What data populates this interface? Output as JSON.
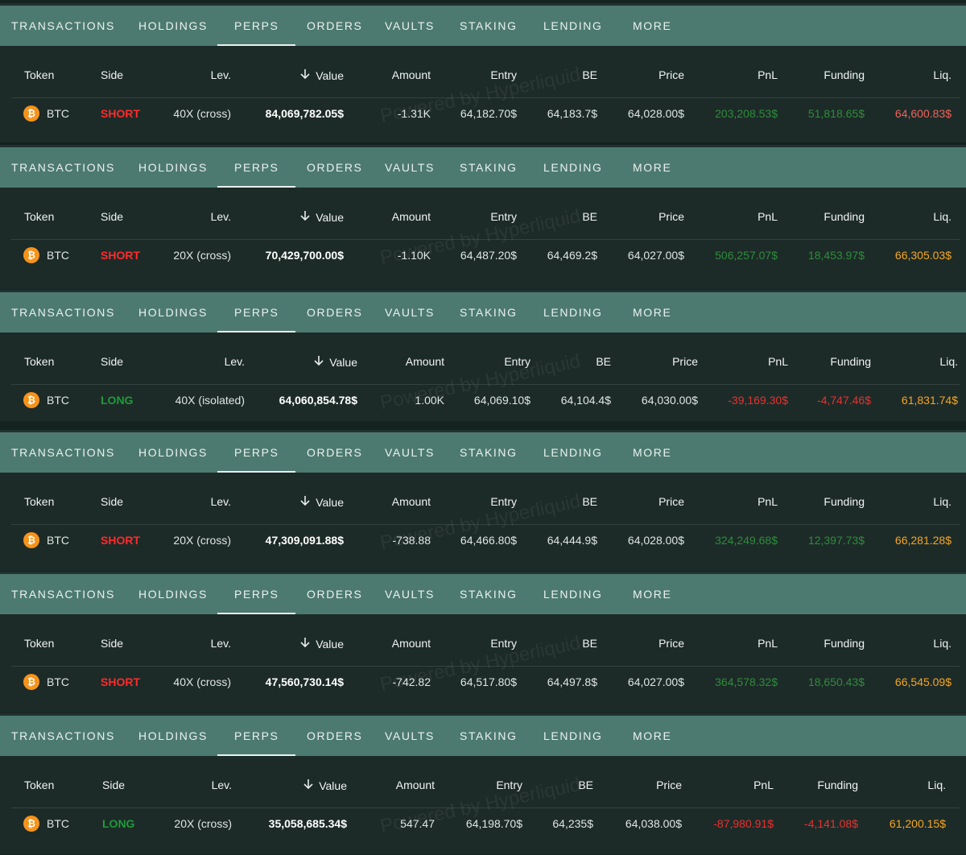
{
  "tabs": [
    "TRANSACTIONS",
    "HOLDINGS",
    "PERPS",
    "ORDERS",
    "VAULTS",
    "STAKING",
    "LENDING",
    "MORE"
  ],
  "active_tab": "PERPS",
  "columns": {
    "token": "Token",
    "side": "Side",
    "lev": "Lev.",
    "value": "Value",
    "amount": "Amount",
    "entry": "Entry",
    "be": "BE",
    "price": "Price",
    "pnl": "PnL",
    "funding": "Funding",
    "liq": "Liq."
  },
  "watermark": "Powered by Hyperliquid",
  "coin_symbol": "₿",
  "colors": {
    "tab_bar": "#4d7a70",
    "background": "#1d2b28",
    "short": "#ff2b2b",
    "long": "#1f9a3a",
    "profit": "#2f8c3c",
    "loss": "#e8312f",
    "liq": "#f5a623"
  },
  "panels": [
    {
      "token": "BTC",
      "side": "SHORT",
      "lev": "40X (cross)",
      "value": "84,069,782.05$",
      "amount": "-1.31K",
      "entry": "64,182.70$",
      "be": "64,183.7$",
      "price": "64,028.00$",
      "pnl": "203,208.53$",
      "funding": "51,818.65$",
      "liq": "64,600.83$"
    },
    {
      "token": "BTC",
      "side": "SHORT",
      "lev": "20X (cross)",
      "value": "70,429,700.00$",
      "amount": "-1.10K",
      "entry": "64,487.20$",
      "be": "64,469.2$",
      "price": "64,027.00$",
      "pnl": "506,257.07$",
      "funding": "18,453.97$",
      "liq": "66,305.03$"
    },
    {
      "token": "BTC",
      "side": "LONG",
      "lev": "40X (isolated)",
      "value": "64,060,854.78$",
      "amount": "1.00K",
      "entry": "64,069.10$",
      "be": "64,104.4$",
      "price": "64,030.00$",
      "pnl": "-39,169.30$",
      "funding": "-4,747.46$",
      "liq": "61,831.74$"
    },
    {
      "token": "BTC",
      "side": "SHORT",
      "lev": "20X (cross)",
      "value": "47,309,091.88$",
      "amount": "-738.88",
      "entry": "64,466.80$",
      "be": "64,444.9$",
      "price": "64,028.00$",
      "pnl": "324,249.68$",
      "funding": "12,397.73$",
      "liq": "66,281.28$"
    },
    {
      "token": "BTC",
      "side": "SHORT",
      "lev": "40X (cross)",
      "value": "47,560,730.14$",
      "amount": "-742.82",
      "entry": "64,517.80$",
      "be": "64,497.8$",
      "price": "64,027.00$",
      "pnl": "364,578.32$",
      "funding": "18,650.43$",
      "liq": "66,545.09$"
    },
    {
      "token": "BTC",
      "side": "LONG",
      "lev": "20X (cross)",
      "value": "35,058,685.34$",
      "amount": "547.47",
      "entry": "64,198.70$",
      "be": "64,235$",
      "price": "64,038.00$",
      "pnl": "-87,980.91$",
      "funding": "-4,141.08$",
      "liq": "61,200.15$"
    }
  ]
}
